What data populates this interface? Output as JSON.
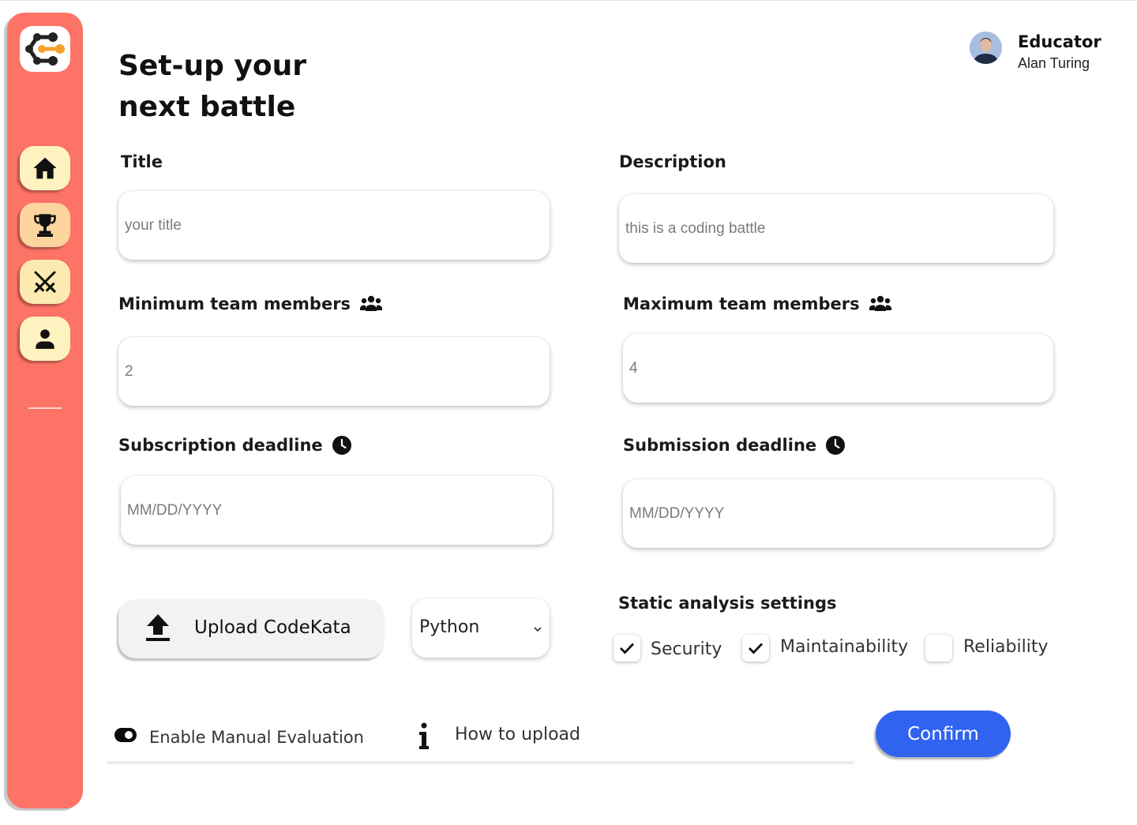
{
  "page": {
    "title_line1": "Set-up your",
    "title_line2": "next battle"
  },
  "user": {
    "role": "Educator",
    "name": "Alan Turing"
  },
  "sidebar": {
    "logo": "codekata-logo",
    "items": [
      {
        "name": "home",
        "icon": "home-icon"
      },
      {
        "name": "leaderboard",
        "icon": "trophy-icon"
      },
      {
        "name": "battles",
        "icon": "crossed-swords-icon"
      },
      {
        "name": "profile",
        "icon": "user-icon"
      }
    ]
  },
  "form": {
    "title_label": "Title",
    "title_placeholder": "your title",
    "description_label": "Description",
    "description_placeholder": "this is a coding battle",
    "min_members_label": "Minimum team members",
    "min_members_value": "2",
    "max_members_label": "Maximum team members",
    "max_members_value": "4",
    "subscription_label": "Subscription deadline",
    "subscription_placeholder": "MM/DD/YYYY",
    "submission_label": "Submission deadline",
    "submission_placeholder": "MM/DD/YYYY",
    "upload_label": "Upload CodeKata",
    "language_selected": "Python"
  },
  "static_analysis": {
    "title": "Static analysis settings",
    "options": [
      {
        "label": "Security",
        "checked": true
      },
      {
        "label": "Maintainability",
        "checked": true
      },
      {
        "label": "Reliability",
        "checked": false
      }
    ]
  },
  "footer": {
    "manual_eval_label": "Enable Manual Evaluation",
    "manual_eval_enabled": true,
    "how_to_upload": "How to upload",
    "confirm_label": "Confirm"
  },
  "colors": {
    "sidebar": "#fd7366",
    "nav_button": "#fef0b3",
    "accent": "#2f63f0",
    "logo_orange": "#f4a12c"
  }
}
